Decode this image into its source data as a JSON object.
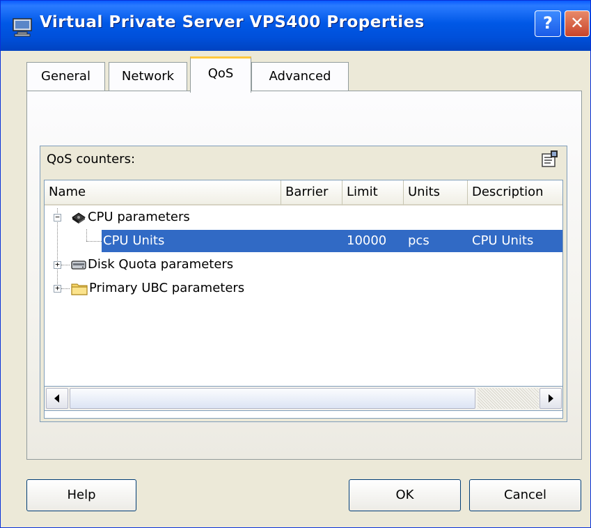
{
  "window": {
    "title": "Virtual Private Server VPS400 Properties",
    "help_glyph": "?",
    "close_glyph": "✕"
  },
  "tabs": [
    {
      "label": "General"
    },
    {
      "label": "Network"
    },
    {
      "label": "QoS",
      "active": true
    },
    {
      "label": "Advanced"
    }
  ],
  "qos": {
    "group_label": "QoS counters:",
    "columns": [
      "Name",
      "Barrier",
      "Limit",
      "Units",
      "Description"
    ],
    "rows": [
      {
        "expander": "−",
        "icon": "cpu-icon",
        "name": "CPU parameters",
        "barrier": "",
        "limit": "",
        "units": "",
        "description": ""
      },
      {
        "expander": "",
        "icon": "",
        "name": "CPU Units",
        "barrier": "",
        "limit": "10000",
        "units": "pcs",
        "description": "CPU Units",
        "selected": true
      },
      {
        "expander": "+",
        "icon": "disk-icon",
        "name": "Disk Quota parameters",
        "barrier": "",
        "limit": "",
        "units": "",
        "description": ""
      },
      {
        "expander": "+",
        "icon": "folder-icon",
        "name": "Primary UBC parameters",
        "barrier": "",
        "limit": "",
        "units": "",
        "description": ""
      }
    ]
  },
  "buttons": {
    "help": "Help",
    "ok": "OK",
    "cancel": "Cancel"
  },
  "colors": {
    "titlebar": "#0058E6",
    "selection": "#316AC5",
    "dialog_bg": "#ECE9D8",
    "active_tab_accent": "#FFC83C"
  }
}
